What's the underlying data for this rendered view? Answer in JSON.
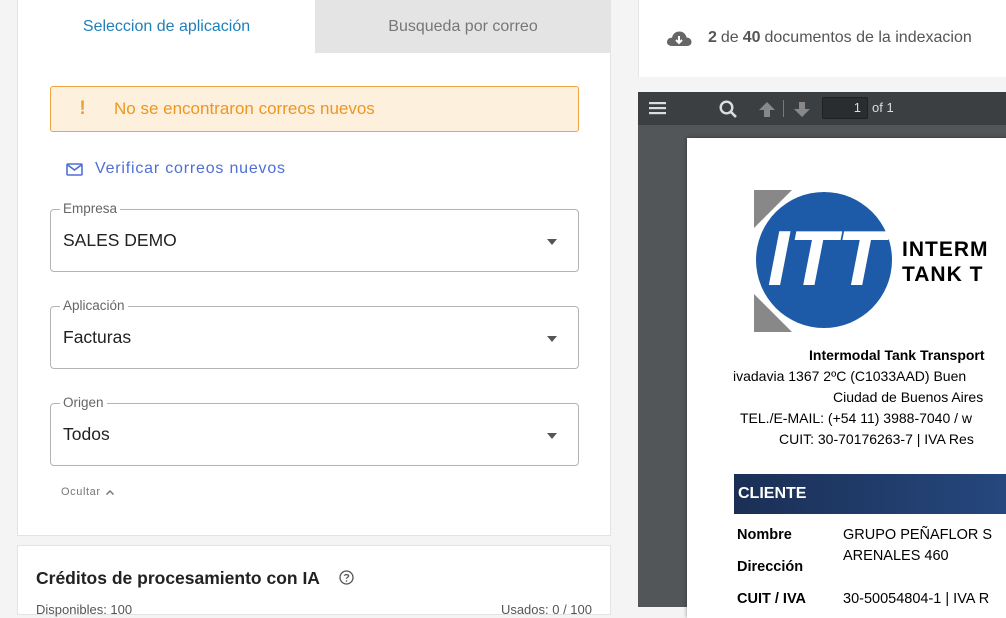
{
  "tabs": {
    "active": "Seleccion de aplicación",
    "inactive": "Busqueda por correo"
  },
  "alert": {
    "icon": "!",
    "text": "No se encontraron correos nuevos"
  },
  "verify": {
    "label": "Verificar correos nuevos",
    "icon": "mail-icon"
  },
  "fields": {
    "empresa": {
      "label": "Empresa",
      "value": "SALES DEMO"
    },
    "aplicacion": {
      "label": "Aplicación",
      "value": "Facturas"
    },
    "origen": {
      "label": "Origen",
      "value": "Todos"
    }
  },
  "collapse_label": "Ocultar",
  "credits": {
    "title": "Créditos de procesamiento con IA",
    "left_text": "Disponibles: 100",
    "right_text": "Usados: 0 / 100"
  },
  "doc_count": {
    "current": "2",
    "of": "de",
    "total": "40",
    "suffix": "documentos de la indexacion"
  },
  "viewer": {
    "page": "1",
    "page_of": "of 1"
  },
  "document": {
    "logo_letters": "ITT",
    "logo_line1": "INTERM",
    "logo_line2": "TANK T",
    "company": "Intermodal Tank Transport",
    "address1": "ivadavia 1367 2ºC (C1033AAD) Buen",
    "address2": "Ciudad de Buenos Aires",
    "address3": "TEL./E-MAIL: (+54 11) 3988-7040 / w",
    "address4": "CUIT: 30-70176263-7 | IVA Res",
    "client_header": "CLIENTE",
    "rows": [
      {
        "label": "Nombre",
        "value": "GRUPO PEÑAFLOR S"
      },
      {
        "label": "Dirección",
        "value": "ARENALES 460"
      },
      {
        "label": "CUIT / IVA",
        "value": "30-50054804-1 | IVA R"
      }
    ]
  },
  "colors": {
    "tab_active": "#1e7fb8",
    "alert_text": "#ef9620",
    "link": "#4f6fd6",
    "client_bar": "#1b2f55"
  }
}
